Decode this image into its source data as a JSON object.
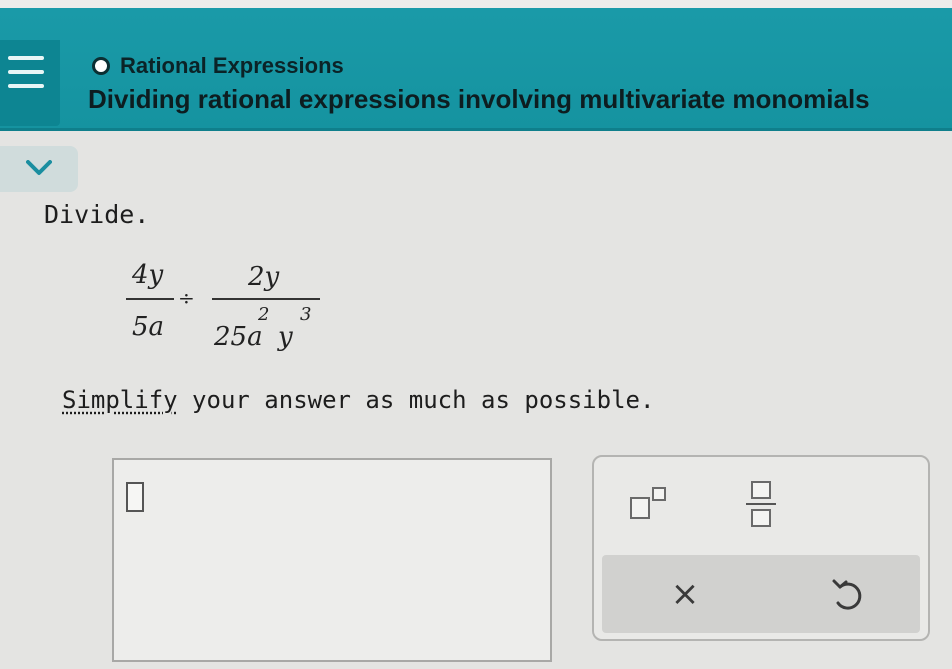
{
  "header": {
    "topic": "Rational Expressions",
    "title": "Dividing rational expressions involving multivariate monomials"
  },
  "problem": {
    "instruction": "Divide.",
    "expression": {
      "fraction1": {
        "numerator": "4y",
        "denominator": "5a"
      },
      "operator": "÷",
      "fraction2": {
        "numerator": "2y",
        "denominator_parts": [
          "25a",
          "2",
          "y",
          "3"
        ]
      }
    },
    "simplify_link": "Simplify",
    "simplify_rest": " your answer as much as possible."
  },
  "toolbar": {
    "exponent_icon": "exponent-template-icon",
    "fraction_icon": "fraction-template-icon",
    "clear_label": "×",
    "undo_icon": "undo-icon"
  },
  "colors": {
    "header_teal": "#1593a0",
    "background": "#e4e4e2"
  }
}
